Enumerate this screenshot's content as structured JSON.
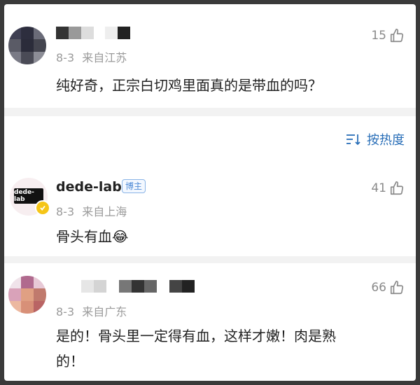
{
  "comments": [
    {
      "date": "8-3",
      "location": "来自江苏",
      "likes": "15",
      "text": "纯好奇，正宗白切鸡里面真的是带血的吗？"
    }
  ],
  "sort": {
    "label": "按热度"
  },
  "replies": [
    {
      "username": "dede-lab",
      "badge": "博主",
      "avatar_text": "dede-lab",
      "date": "8-3",
      "location": "来自上海",
      "likes": "41",
      "text": "骨头有血",
      "emoji": "😂"
    },
    {
      "date": "8-3",
      "location": "来自广东",
      "likes": "66",
      "text_line1": "是的！骨头里一定得有血，这样才嫩！肉是熟",
      "text_line2": "的！"
    }
  ],
  "colors": {
    "link_blue": "#2a6fb8",
    "meta_gray": "#9a9a9a",
    "badge_blue": "#4e8ad6",
    "verify_yellow": "#f5c518"
  }
}
